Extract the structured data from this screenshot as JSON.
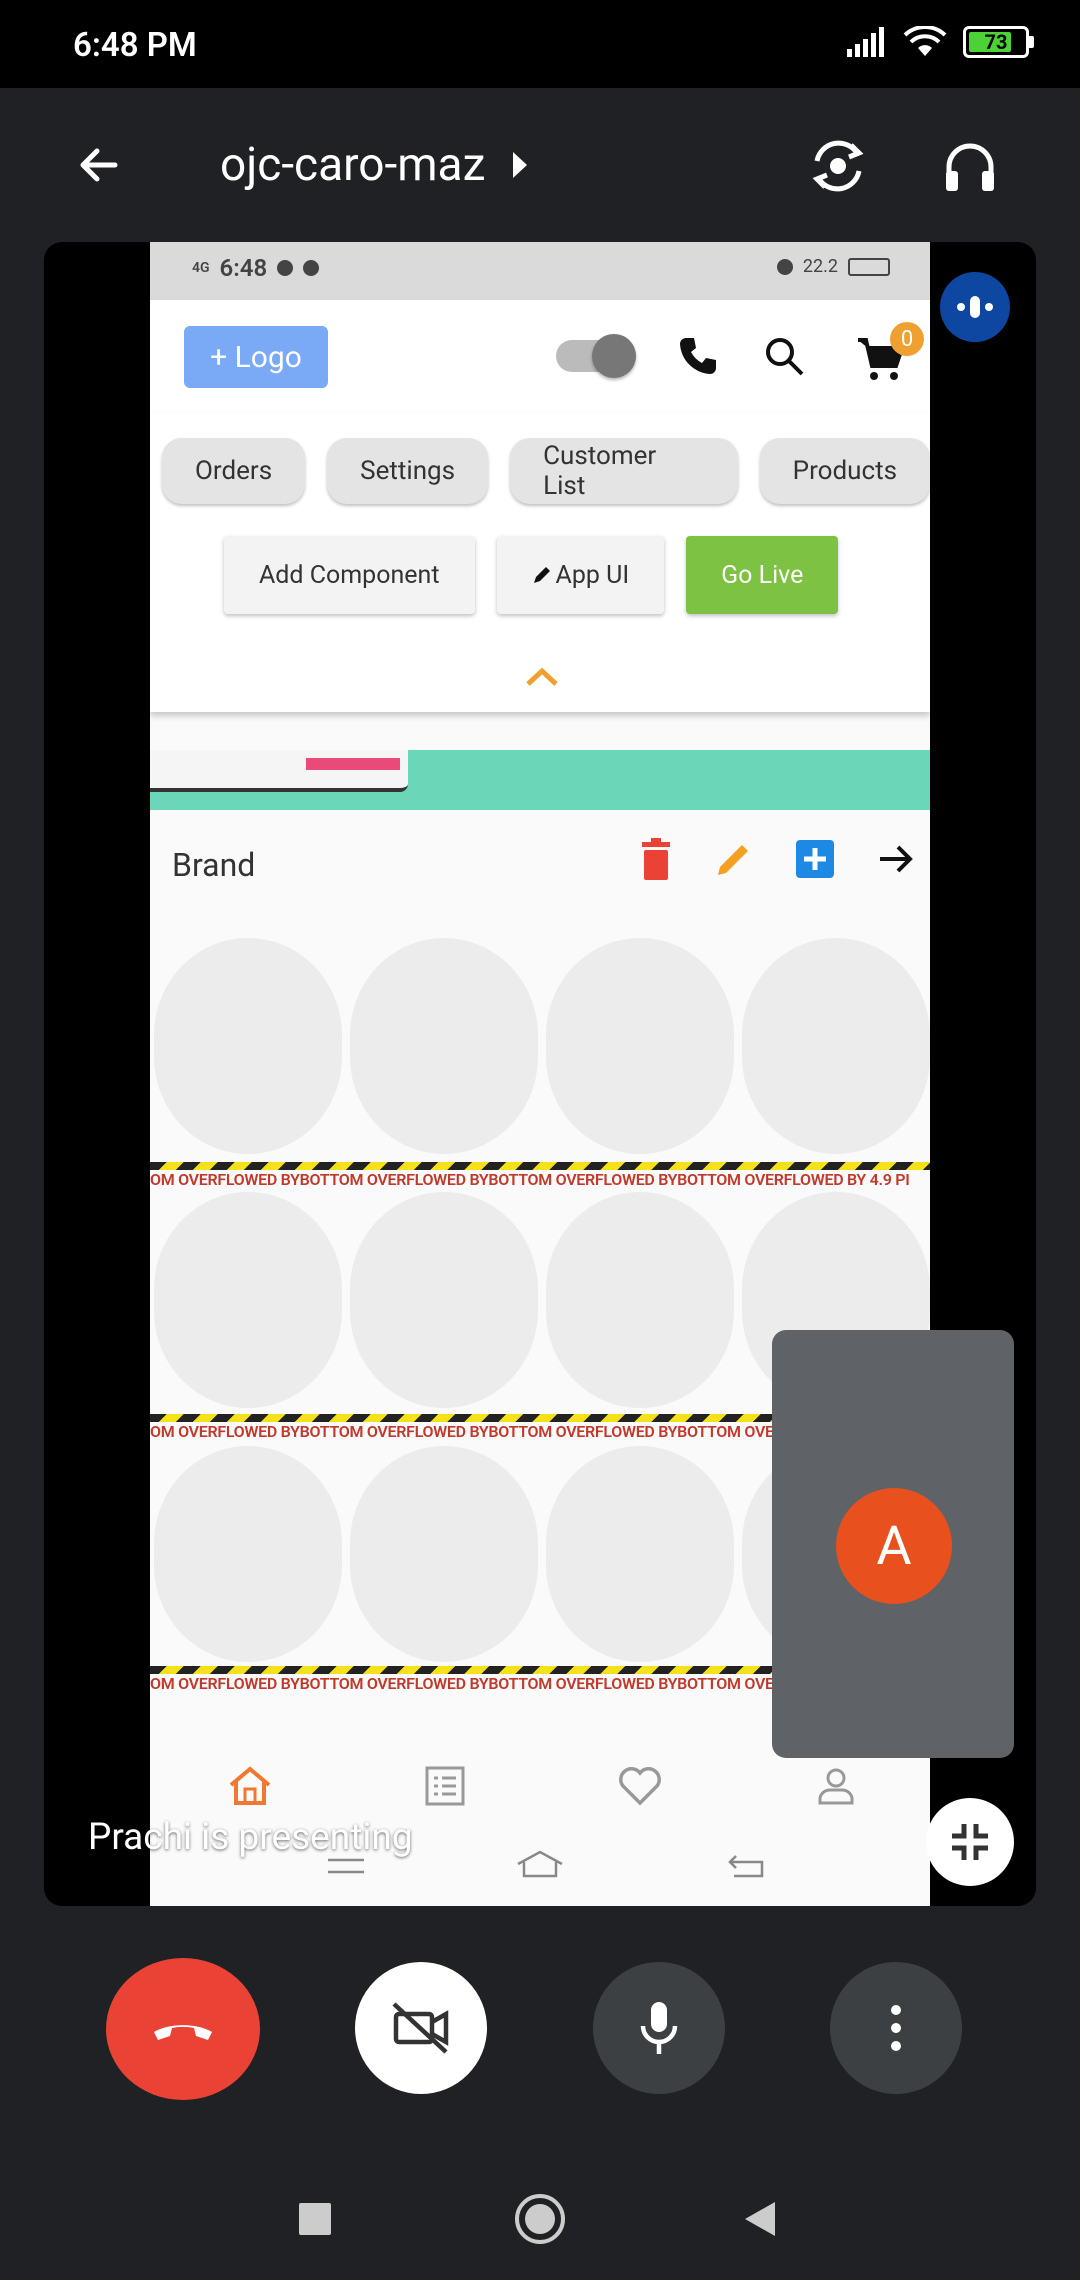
{
  "status_bar": {
    "time": "6:48 PM",
    "battery": "73"
  },
  "header": {
    "meeting_code": "ojc-caro-maz"
  },
  "shared_screen": {
    "status": {
      "network": "4G",
      "time": "6:48",
      "speed": "22.2"
    },
    "appbar": {
      "logo_label": "+ Logo",
      "cart_count": "0"
    },
    "menu_chips": [
      "Orders",
      "Settings",
      "Customer List",
      "Products"
    ],
    "actions": {
      "add_component": "Add Component",
      "app_ui": "App UI",
      "go_live": "Go Live"
    },
    "brand_label": "Brand",
    "overflow_rows": [
      "OM OVERFLOWED BYBOTTOM OVERFLOWED BYBOTTOM OVERFLOWED BYBOTTOM OVERFLOWED BY 4.9 PI",
      "OM OVERFLOWED BYBOTTOM OVERFLOWED BYBOTTOM OVERFLOWED BYBOTTOM OVERFLOWED BY 4.9 PI",
      "OM OVERFLOWED BYBOTTOM OVERFLOWED BYBOTTOM OVERFLOWED BYBOTTOM OVERFLOWED BY 4.9 PI"
    ],
    "colors": {
      "accent": "#7dc242",
      "logo": "#7aa9f5",
      "banner": "#6cd7b8",
      "delete": "#ea4335",
      "edit": "#f4a020",
      "add": "#1e88e5"
    }
  },
  "self_tile": {
    "initial": "A"
  },
  "presenting_text": "Prachi is presenting",
  "icons": [
    "back-icon",
    "switch-camera-icon",
    "headphones-icon",
    "phone-icon",
    "search-icon",
    "cart-icon",
    "delete-icon",
    "edit-icon",
    "add-box-icon",
    "arrow-forward-icon",
    "home-icon",
    "list-icon",
    "heart-icon",
    "person-icon",
    "minimize-icon",
    "end-call-icon",
    "camera-off-icon",
    "mic-icon",
    "more-vert-icon"
  ]
}
